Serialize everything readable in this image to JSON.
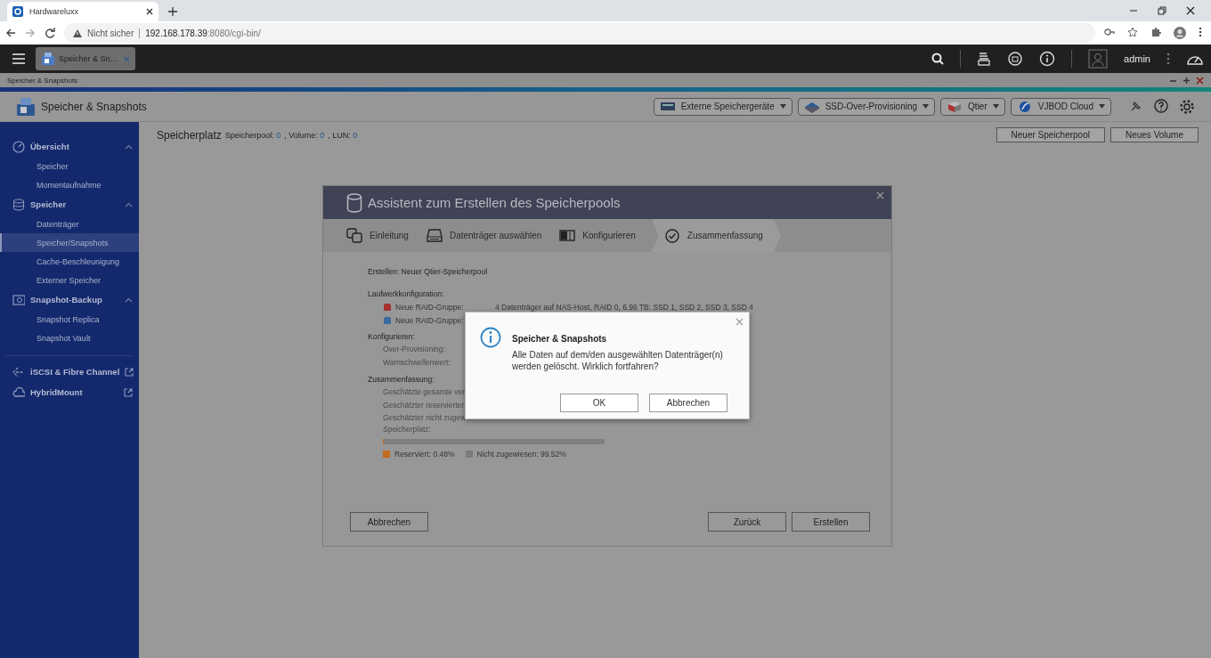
{
  "browser": {
    "tab_title": "Hardwareluxx",
    "warning": "Nicht sicher",
    "url_host": "192.168.178.39",
    "url_rest": ":8080/cgi-bin/"
  },
  "topbar": {
    "app_tab": "Speicher & Sn…",
    "user": "admin"
  },
  "app": {
    "window_title": "Speicher & Snapshots",
    "title": "Speicher & Snapshots",
    "toolbar_buttons": [
      {
        "label": "Externe Speichergeräte",
        "kind": "external"
      },
      {
        "label": "SSD-Over-Provisioning",
        "kind": "ssd"
      },
      {
        "label": "Qtier",
        "kind": "qtier"
      },
      {
        "label": "VJBOD Cloud",
        "kind": "cloud"
      }
    ]
  },
  "sidebar": {
    "items": [
      {
        "label": "Übersicht",
        "kind": "gauge",
        "expanded": true,
        "children": [
          {
            "label": "Speicher",
            "selected": false
          },
          {
            "label": "Momentaufnahme",
            "selected": false
          }
        ]
      },
      {
        "label": "Speicher",
        "kind": "db",
        "expanded": true,
        "children": [
          {
            "label": "Datenträger",
            "selected": false
          },
          {
            "label": "Speicher/Snapshots",
            "selected": true
          },
          {
            "label": "Cache-Beschleunigung",
            "selected": false
          },
          {
            "label": "Externer Speicher",
            "selected": false
          }
        ]
      },
      {
        "label": "Snapshot-Backup",
        "kind": "camera",
        "expanded": true,
        "children": [
          {
            "label": "Snapshot Replica",
            "selected": false
          },
          {
            "label": "Snapshot Vault",
            "selected": false
          }
        ]
      },
      {
        "label": "iSCSI & Fibre Channel",
        "kind": "link",
        "external": true
      },
      {
        "label": "HybridMount",
        "kind": "cloud",
        "external": true
      }
    ]
  },
  "main": {
    "heading": "Speicherplatz",
    "stats": [
      {
        "label": "Speicherpool:",
        "value": "0"
      },
      {
        "label": ", Volume:",
        "value": "0"
      },
      {
        "label": ", LUN:",
        "value": "0"
      }
    ],
    "buttons": [
      "Neuer Speicherpool",
      "Neues Volume"
    ]
  },
  "wizard": {
    "title": "Assistent zum Erstellen des Speicherpools",
    "steps": [
      {
        "label": "Einleitung",
        "kind": "intro",
        "selected": false
      },
      {
        "label": "Datenträger auswählen",
        "kind": "disk",
        "selected": false
      },
      {
        "label": "Konfigurieren",
        "kind": "config",
        "selected": false
      },
      {
        "label": "Zusammenfassung",
        "kind": "check",
        "selected": true
      }
    ],
    "rows": [
      {
        "kind": "text",
        "text": "Erstellen: Neuer Qtier-Speicherpool"
      },
      {
        "kind": "heading",
        "text": "Laufwerkkonfiguration:"
      },
      {
        "kind": "raid",
        "color": "#a8312e",
        "label": "Neue RAID-Gruppe:",
        "value": "4 Datenträger auf NAS-Host, RAID 0, 6.96 TB: SSD 1, SSD 2, SSD 3, SSD 4"
      },
      {
        "kind": "raid",
        "color": "#3a6aa0",
        "label": "Neue RAID-Gruppe:"
      },
      {
        "kind": "heading",
        "text": "Konfigurieren:"
      },
      {
        "kind": "field",
        "text": "Over-Provisioning:"
      },
      {
        "kind": "field",
        "text": "Warnschwellenwert:"
      },
      {
        "kind": "heading",
        "text": "Zusammenfassung:"
      },
      {
        "kind": "field",
        "text": "Geschätzte gesamte ver"
      },
      {
        "kind": "field",
        "text": "Geschätzter reservierter"
      },
      {
        "kind": "field",
        "text": "Geschätzter nicht zugew\nSpeicherplatz:"
      },
      {
        "kind": "bar",
        "level": 0.0048
      },
      {
        "kind": "legend",
        "items": [
          {
            "color": "#c46a1c",
            "label": "Reserviert: 0.48%"
          },
          {
            "color": "#7c7c7c",
            "label": "Nicht zugewiesen: 99.52%"
          }
        ]
      }
    ],
    "left_buttons": [
      "Abbrechen"
    ],
    "right_buttons": [
      "Zurück",
      "Erstellen"
    ]
  },
  "alert": {
    "title": "Speicher & Snapshots",
    "message": "Alle Daten auf dem/den ausgewählten Datenträger(n) werden gelöscht. Wirklich fortfahren?",
    "buttons": [
      "OK",
      "Abbrechen"
    ]
  }
}
